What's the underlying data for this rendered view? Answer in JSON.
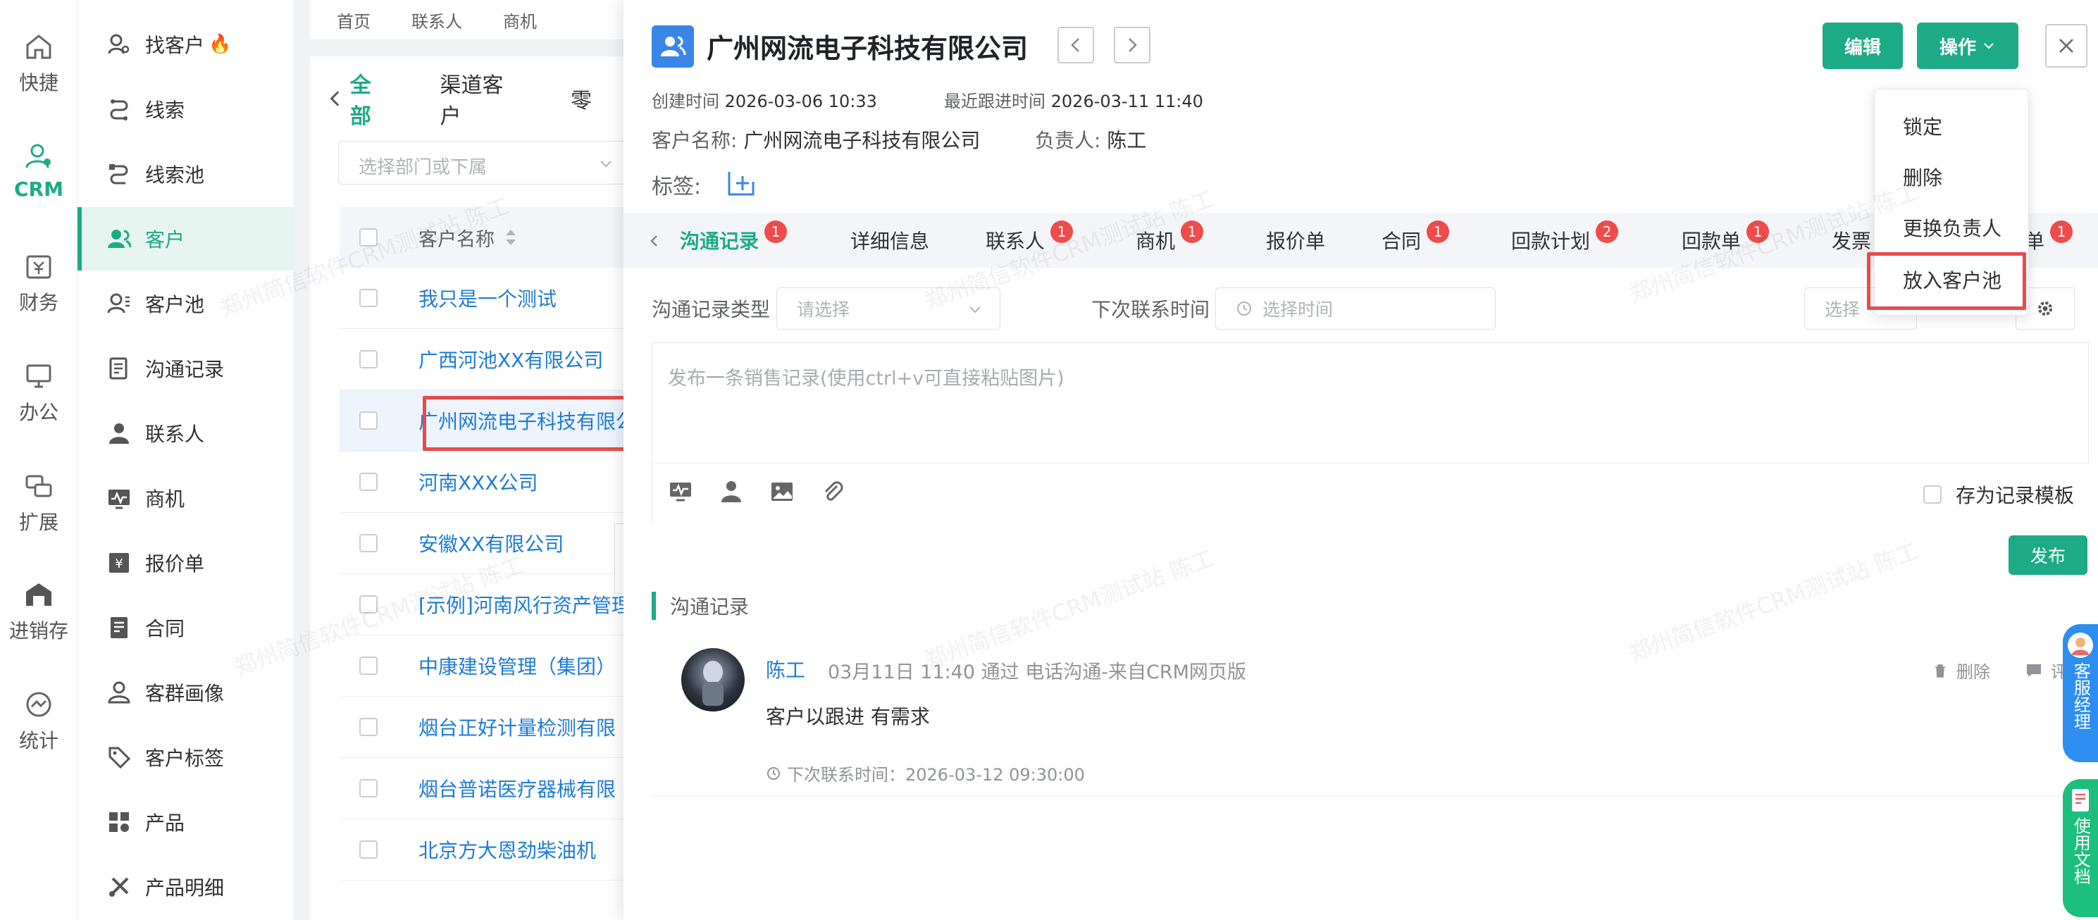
{
  "rail": [
    {
      "label": "快捷",
      "icon": "home-icon"
    },
    {
      "label": "CRM",
      "icon": "crm-icon",
      "active": true
    },
    {
      "label": "财务",
      "icon": "finance-icon"
    },
    {
      "label": "办公",
      "icon": "office-icon"
    },
    {
      "label": "扩展",
      "icon": "extend-icon"
    },
    {
      "label": "进销存",
      "icon": "warehouse-icon"
    },
    {
      "label": "统计",
      "icon": "stats-icon"
    }
  ],
  "menu": [
    {
      "label": "找客户",
      "icon": "find-customer-icon",
      "hot": "🔥"
    },
    {
      "label": "线索",
      "icon": "lead-icon"
    },
    {
      "label": "线索池",
      "icon": "lead-pool-icon"
    },
    {
      "label": "客户",
      "icon": "customer-icon",
      "active": true
    },
    {
      "label": "客户池",
      "icon": "customer-pool-icon"
    },
    {
      "label": "沟通记录",
      "icon": "communication-icon"
    },
    {
      "label": "联系人",
      "icon": "contact-icon"
    },
    {
      "label": "商机",
      "icon": "opportunity-icon"
    },
    {
      "label": "报价单",
      "icon": "quotation-icon"
    },
    {
      "label": "合同",
      "icon": "contract-icon"
    },
    {
      "label": "客群画像",
      "icon": "profile-icon"
    },
    {
      "label": "客户标签",
      "icon": "tag-icon"
    },
    {
      "label": "产品",
      "icon": "product-icon"
    },
    {
      "label": "产品明细",
      "icon": "product-detail-icon"
    }
  ],
  "topnav": [
    "首页",
    "联系人",
    "商机"
  ],
  "list": {
    "tabs": [
      "全部",
      "渠道客户",
      "零"
    ],
    "dept_placeholder": "选择部门或下属",
    "col_header": "客户名称",
    "rows": [
      "我只是一个测试",
      "广西河池XX有限公司",
      "广州网流电子科技有限公司",
      "河南XXX公司",
      "安徽XX有限公司",
      "[示例]河南风行资产管理",
      "中康建设管理（集团）",
      "烟台正好计量检测有限",
      "烟台普诺医疗器械有限",
      "北京方大恩劲柴油机"
    ]
  },
  "drawer": {
    "title": "广州网流电子科技有限公司",
    "edit_label": "编辑",
    "ops_label": "操作",
    "created_label": "创建时间",
    "created_value": "2026-03-06 10:33",
    "last_follow_label": "最近跟进时间",
    "last_follow_value": "2026-03-11 11:40",
    "name_label": "客户名称:",
    "name_value": "广州网流电子科技有限公司",
    "owner_label": "负责人:",
    "owner_value": "陈工",
    "tags_label": "标签:",
    "tabs": [
      {
        "label": "沟通记录",
        "badge": "1"
      },
      {
        "label": "详细信息",
        "badge": ""
      },
      {
        "label": "联系人",
        "badge": "1"
      },
      {
        "label": "商机",
        "badge": "1"
      },
      {
        "label": "报价单",
        "badge": ""
      },
      {
        "label": "合同",
        "badge": "1"
      },
      {
        "label": "回款计划",
        "badge": "2"
      },
      {
        "label": "回款单",
        "badge": "1"
      },
      {
        "label": "发票",
        "badge": ""
      },
      {
        "label": "单",
        "badge": "1"
      }
    ],
    "filter_type_label": "沟通记录类型",
    "filter_type_placeholder": "请选择",
    "next_contact_label": "下次联系时间",
    "next_contact_placeholder": "选择时间",
    "right_select_placeholder": "选择",
    "editor_placeholder": "发布一条销售记录(使用ctrl+v可直接粘贴图片)",
    "save_template_label": "存为记录模板",
    "publish_label": "发布",
    "section_title": "沟通记录",
    "record": {
      "author": "陈工",
      "meta": "03月11日 11:40 通过 电话沟通-来自CRM网页版",
      "body": "客户以跟进  有需求",
      "next_contact": "下次联系时间：2026-03-12 09:30:00",
      "delete_label": "删除",
      "comment_label": "评"
    },
    "dropdown": [
      "锁定",
      "删除",
      "更换负责人",
      "放入客户池"
    ]
  },
  "float_tabs": [
    "客服经理",
    "使用文档"
  ],
  "watermark": "郑州简信软件CRM测试站 陈工",
  "colors": {
    "accent": "#1cab86",
    "link": "#1f7bd6",
    "badge": "#ef4b4b",
    "highlight_box": "#e94b4b"
  }
}
